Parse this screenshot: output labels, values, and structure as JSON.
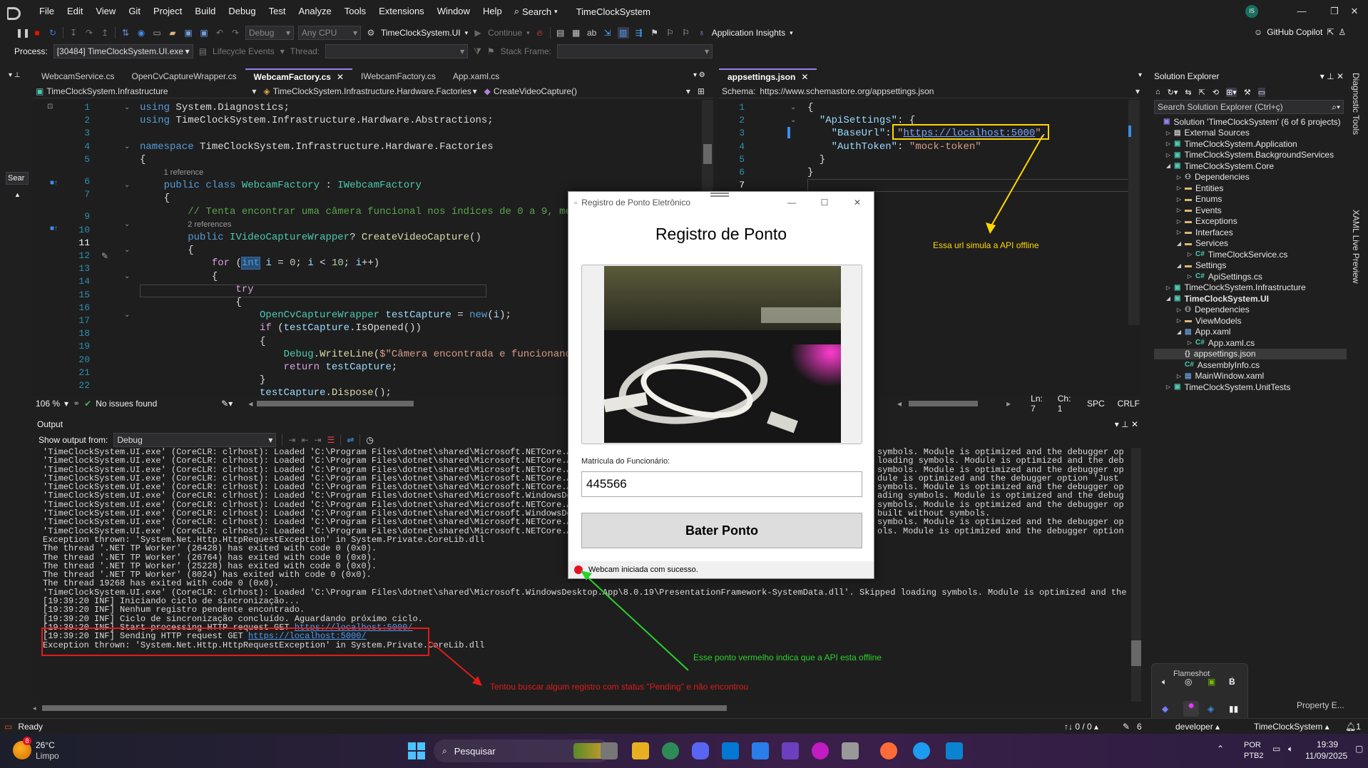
{
  "menu": [
    "File",
    "Edit",
    "View",
    "Git",
    "Project",
    "Build",
    "Debug",
    "Test",
    "Analyze",
    "Tools",
    "Extensions",
    "Window",
    "Help"
  ],
  "search_label": "Search",
  "solution_title": "TimeClockSystem",
  "avatar_initials": "IS",
  "toolbar": {
    "config": "Debug",
    "platform": "Any CPU",
    "startup": "TimeClockSystem.UI",
    "continue_label": "Continue",
    "app_insights": "Application Insights",
    "copilot": "GitHub Copilot"
  },
  "debugbar": {
    "process_label": "Process:",
    "process_value": "[30484] TimeClockSystem.UI.exe",
    "lifecycle": "Lifecycle Events",
    "thread_label": "Thread:",
    "stackframe_label": "Stack Frame:"
  },
  "editor_left": {
    "tabs": [
      "WebcamService.cs",
      "OpenCvCaptureWrapper.cs",
      "WebcamFactory.cs",
      "IWebcamFactory.cs",
      "App.xaml.cs"
    ],
    "active_tab": "WebcamFactory.cs",
    "nav1": "TimeClockSystem.Infrastructure",
    "nav2": "TimeClockSystem.Infrastructure.Hardware.Factories",
    "nav3": "CreateVideoCapture()",
    "side_tab": "Sear",
    "zoom": "106 %",
    "issues": "No issues found"
  },
  "editor_right": {
    "tab": "appsettings.json",
    "schema_label": "Schema:",
    "schema_url": "https://www.schemastore.org/appsettings.json",
    "ln": "Ln: 7",
    "ch": "Ch: 1",
    "spc": "SPC",
    "crlf": "CRLF"
  },
  "json_lines": [
    "{",
    "  \"ApiSettings\": {",
    "    \"BaseUrl\": \"https://localhost:5000\",",
    "    \"AuthToken\": \"mock-token\"",
    "  }",
    "}",
    ""
  ],
  "code_refs": {
    "r1": "1 reference",
    "r2": "2 references"
  },
  "output": {
    "title": "Output",
    "show_from": "Show output from:",
    "source": "Debug",
    "lines": [
      "'TimeClockSystem.UI.exe' (CoreCLR: clrhost): Loaded 'C:\\Program Files\\dotnet\\shared\\Microsoft.NETCore.App",
      "'TimeClockSystem.UI.exe' (CoreCLR: clrhost): Loaded 'C:\\Program Files\\dotnet\\shared\\Microsoft.NETCore.App",
      "'TimeClockSystem.UI.exe' (CoreCLR: clrhost): Loaded 'C:\\Program Files\\dotnet\\shared\\Microsoft.NETCore.App",
      "'TimeClockSystem.UI.exe' (CoreCLR: clrhost): Loaded 'C:\\Program Files\\dotnet\\shared\\Microsoft.NETCore.App",
      "'TimeClockSystem.UI.exe' (CoreCLR: clrhost): Loaded 'C:\\Program Files\\dotnet\\shared\\Microsoft.NETCore.App",
      "'TimeClockSystem.UI.exe' (CoreCLR: clrhost): Loaded 'C:\\Program Files\\dotnet\\shared\\Microsoft.WindowsDesk",
      "'TimeClockSystem.UI.exe' (CoreCLR: clrhost): Loaded 'C:\\Program Files\\dotnet\\shared\\Microsoft.NETCore.App",
      "'TimeClockSystem.UI.exe' (CoreCLR: clrhost): Loaded 'C:\\Program Files\\dotnet\\shared\\Microsoft.WindowsDesk",
      "'TimeClockSystem.UI.exe' (CoreCLR: clrhost): Loaded 'C:\\Program Files\\dotnet\\shared\\Microsoft.NETCore.App",
      "'TimeClockSystem.UI.exe' (CoreCLR: clrhost): Loaded 'C:\\Program Files\\dotnet\\shared\\Microsoft.NETCore.App",
      "Exception thrown: 'System.Net.Http.HttpRequestException' in System.Private.CoreLib.dll",
      "The thread '.NET TP Worker' (26428) has exited with code 0 (0x0).",
      "The thread '.NET TP Worker' (26764) has exited with code 0 (0x0).",
      "The thread '.NET TP Worker' (25228) has exited with code 0 (0x0).",
      "The thread '.NET TP Worker' (8024) has exited with code 0 (0x0).",
      "The thread 19268 has exited with code 0 (0x0).",
      "'TimeClockSystem.UI.exe' (CoreCLR: clrhost): Loaded 'C:\\Program Files\\dotnet\\shared\\Microsoft.WindowsDesktop.App\\8.0.19\\PresentationFramework-SystemData.dll'. Skipped loading symbols. Module is optimized and the debugg",
      "[19:39:20 INF] Iniciando ciclo de sincronização...",
      "[19:39:20 INF] Nenhum registro pendente encontrado.",
      "[19:39:20 INF] Ciclo de sincronização concluído. Aguardando próximo ciclo.",
      "[19:39:20 INF] Start processing HTTP request GET ",
      "[19:39:20 INF] Sending HTTP request GET ",
      "Exception thrown: 'System.Net.Http.HttpRequestException' in System.Private.CoreLib.dll"
    ],
    "right_tails": [
      "symbols. Module is optimized and the debugger opti",
      "loading symbols. Module is optimized and the debugg",
      "symbols. Module is optimized and the debugger opti",
      "dule is optimized and the debugger option 'Just My C",
      "symbols. Module is optimized and the debugger option",
      "ading symbols. Module is optimized and the debugger",
      "symbols. Module is optimized and the debugger option 'Just My",
      "built without symbols.",
      "symbols. Module is optimized and the debugger option",
      "ols. Module is optimized and the debugger option 'Ju"
    ],
    "localhost": "https://localhost:5000/"
  },
  "solution_explorer": {
    "title": "Solution Explorer",
    "search_placeholder": "Search Solution Explorer (Ctrl+ç)",
    "items": [
      {
        "label": "Solution 'TimeClockSystem' (6 of 6 projects)",
        "indent": 0,
        "icon": "sol",
        "tri": ""
      },
      {
        "label": "External Sources",
        "indent": 1,
        "icon": "ext",
        "tri": "▷"
      },
      {
        "label": "TimeClockSystem.Application",
        "indent": 1,
        "icon": "proj",
        "tri": "▷"
      },
      {
        "label": "TimeClockSystem.BackgroundServices",
        "indent": 1,
        "icon": "proj",
        "tri": "▷"
      },
      {
        "label": "TimeClockSystem.Core",
        "indent": 1,
        "icon": "proj",
        "tri": "◢"
      },
      {
        "label": "Dependencies",
        "indent": 2,
        "icon": "dep",
        "tri": "▷"
      },
      {
        "label": "Entities",
        "indent": 2,
        "icon": "folder",
        "tri": "▷"
      },
      {
        "label": "Enums",
        "indent": 2,
        "icon": "folder",
        "tri": "▷"
      },
      {
        "label": "Events",
        "indent": 2,
        "icon": "folder",
        "tri": "▷"
      },
      {
        "label": "Exceptions",
        "indent": 2,
        "icon": "folder",
        "tri": "▷"
      },
      {
        "label": "Interfaces",
        "indent": 2,
        "icon": "folder",
        "tri": "▷"
      },
      {
        "label": "Services",
        "indent": 2,
        "icon": "folder",
        "tri": "◢"
      },
      {
        "label": "TimeClockService.cs",
        "indent": 3,
        "icon": "cs",
        "tri": "▷"
      },
      {
        "label": "Settings",
        "indent": 2,
        "icon": "folder",
        "tri": "◢"
      },
      {
        "label": "ApiSettings.cs",
        "indent": 3,
        "icon": "cs",
        "tri": "▷"
      },
      {
        "label": "TimeClockSystem.Infrastructure",
        "indent": 1,
        "icon": "proj",
        "tri": "▷"
      },
      {
        "label": "TimeClockSystem.UI",
        "indent": 1,
        "icon": "proj",
        "tri": "◢",
        "bold": true
      },
      {
        "label": "Dependencies",
        "indent": 2,
        "icon": "dep",
        "tri": "▷"
      },
      {
        "label": "ViewModels",
        "indent": 2,
        "icon": "folder",
        "tri": "▷"
      },
      {
        "label": "App.xaml",
        "indent": 2,
        "icon": "xaml",
        "tri": "◢"
      },
      {
        "label": "App.xaml.cs",
        "indent": 3,
        "icon": "cs",
        "tri": "▷"
      },
      {
        "label": "appsettings.json",
        "indent": 2,
        "icon": "json",
        "tri": "",
        "selected": true
      },
      {
        "label": "AssemblyInfo.cs",
        "indent": 2,
        "icon": "cs",
        "tri": ""
      },
      {
        "label": "MainWindow.xaml",
        "indent": 2,
        "icon": "xaml",
        "tri": "▷"
      },
      {
        "label": "TimeClockSystem.UnitTests",
        "indent": 1,
        "icon": "proj",
        "tri": "▷"
      }
    ],
    "property": "Property E..."
  },
  "side_tools": [
    "Diagnostic Tools",
    "XAML Live Preview"
  ],
  "app": {
    "window_title": "Registro de Ponto Eletrônico",
    "heading": "Registro de Ponto",
    "matricula_label": "Matrícula do Funcionário:",
    "matricula_value": "445566",
    "button": "Bater Ponto",
    "status": "Webcam iniciada com sucesso."
  },
  "annotations": {
    "api_url": "Essa url simula a API offline",
    "red_dot": "Esse ponto vermelho indica que a API esta offline",
    "pending": "Tentou buscar algum registro com status \"Pending\" e não encontrou"
  },
  "statusbar": {
    "ready": "Ready",
    "git": "↑↓ 0 / 0 ▴",
    "pencil": "6",
    "branch": "developer ▴",
    "repo": "TimeClockSystem ▴",
    "bell": "1"
  },
  "taskbar": {
    "temp": "26°C",
    "weather": "Limpo",
    "weather_badge": "8",
    "search": "Pesquisar",
    "lang1": "POR",
    "lang2": "PTB2",
    "time": "19:39",
    "date": "11/09/2025",
    "flameshot": "Flameshot"
  },
  "colors": {
    "accent": "#9a7ef0",
    "yellow": "#ffd700",
    "green": "#2bd12b",
    "red": "#e01b1b",
    "status_dot": "#e81123"
  }
}
